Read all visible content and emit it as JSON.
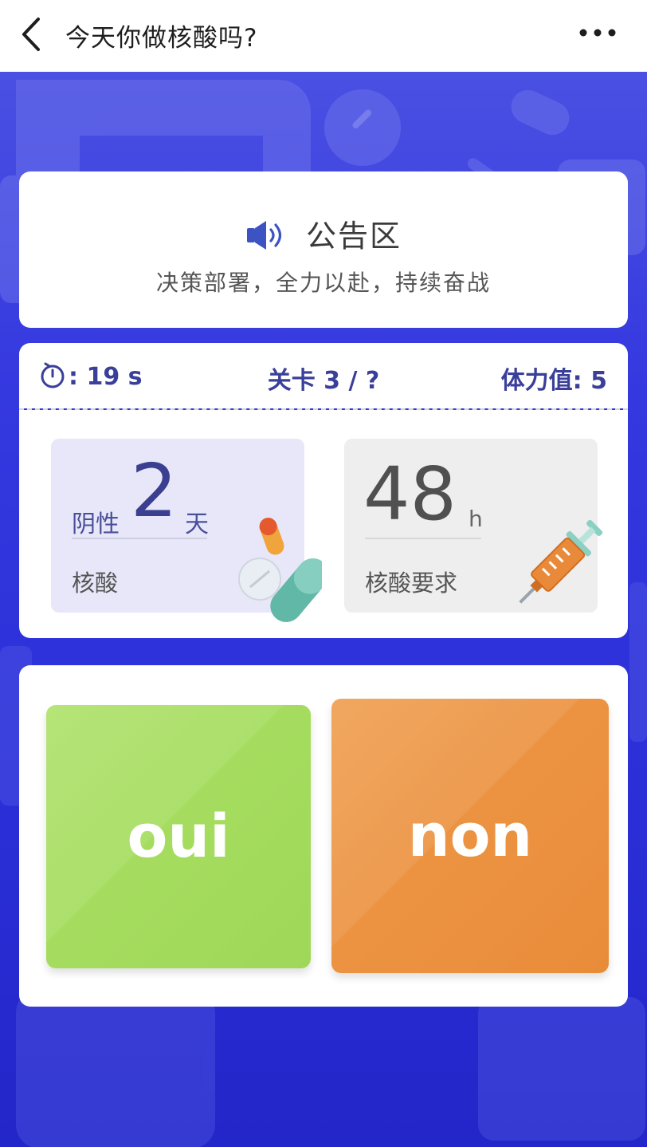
{
  "header": {
    "title": "今天你做核酸吗?",
    "back_icon": "chevron-left-icon",
    "more_icon": "more-horizontal-icon"
  },
  "notice": {
    "title": "公告区",
    "text": "决策部署，全力以赴，持续奋战",
    "icon": "speaker-icon"
  },
  "status": {
    "timer_icon": "stopwatch-icon",
    "timer_text": ": 19 s",
    "level_text": "关卡 3 / ?",
    "stamina_text": "体力值: 5"
  },
  "negative_card": {
    "prefix": "阴性",
    "value": "2",
    "unit": "天",
    "label": "核酸",
    "illustration": "pills-icon"
  },
  "requirement_card": {
    "value": "48",
    "unit": "h",
    "label": "核酸要求",
    "illustration": "syringe-icon"
  },
  "answers": {
    "yes_label": "oui",
    "no_label": "non"
  },
  "colors": {
    "background": "#2b2fd8",
    "yes": "#a6dd60",
    "no": "#ec9443",
    "accent_text": "#3a3f9a"
  }
}
